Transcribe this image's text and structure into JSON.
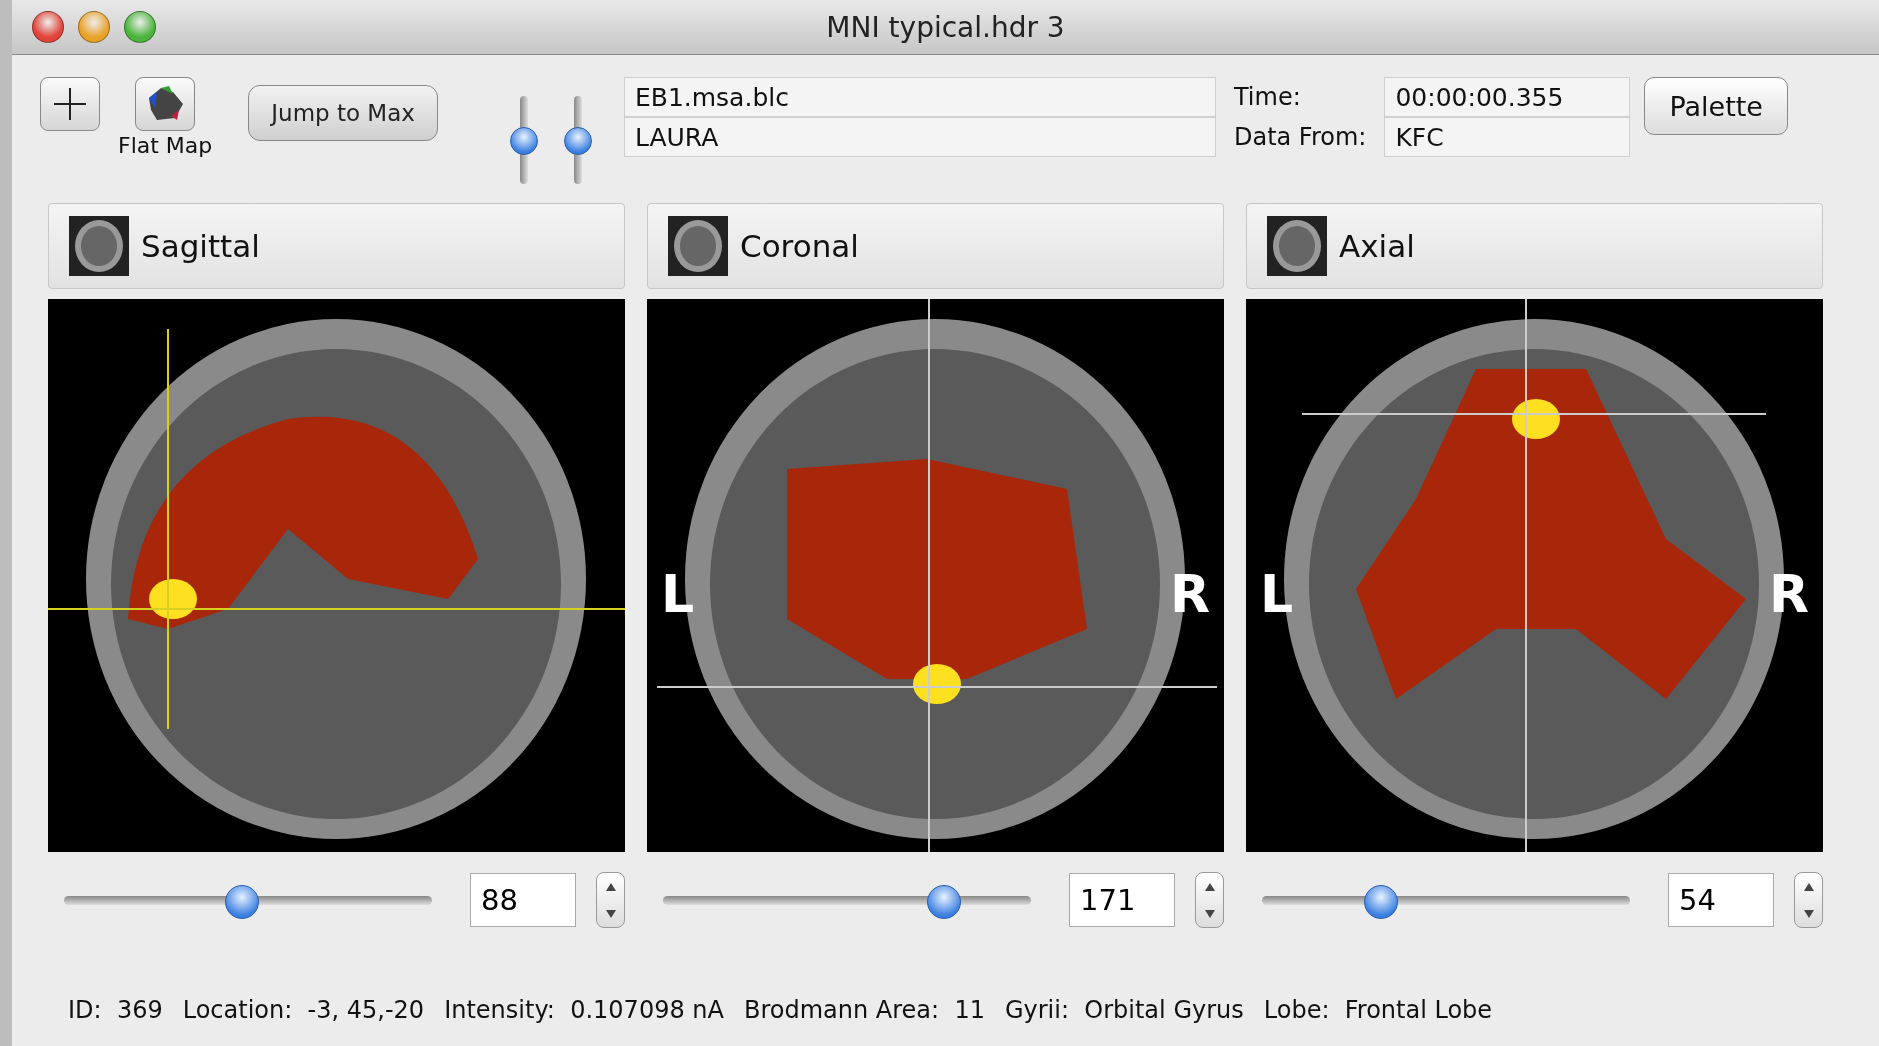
{
  "window": {
    "title": "MNI typical.hdr 3"
  },
  "toolbar": {
    "flat_map_label": "Flat Map",
    "jump_button": "Jump to Max",
    "vsliders": [
      {
        "level": 0.48
      },
      {
        "level": 0.48
      }
    ],
    "fields": [
      "EB1.msa.blc",
      "LAURA"
    ],
    "time_label": "Time:",
    "time_value": "00:00:00.355",
    "data_from_label": "Data From:",
    "data_from_value": "KFC",
    "palette_button": "Palette"
  },
  "views": [
    {
      "kind": "sagittal",
      "title": "Sagittal",
      "level": 0.48,
      "value": "88"
    },
    {
      "kind": "coronal",
      "title": "Coronal",
      "level": 0.76,
      "value": "171",
      "left_label": "L",
      "right_label": "R"
    },
    {
      "kind": "axial",
      "title": "Axial",
      "level": 0.32,
      "value": "54",
      "left_label": "L",
      "right_label": "R"
    }
  ],
  "status": [
    {
      "label": "ID:",
      "value": "369"
    },
    {
      "label": "Location:",
      "value": "-3, 45,-20"
    },
    {
      "label": "Intensity:",
      "value": "0.107098 nA"
    },
    {
      "label": "Brodmann Area:",
      "value": "11"
    },
    {
      "label": "Gyrii:",
      "value": "Orbital Gyrus"
    },
    {
      "label": "Lobe:",
      "value": "Frontal Lobe"
    }
  ]
}
